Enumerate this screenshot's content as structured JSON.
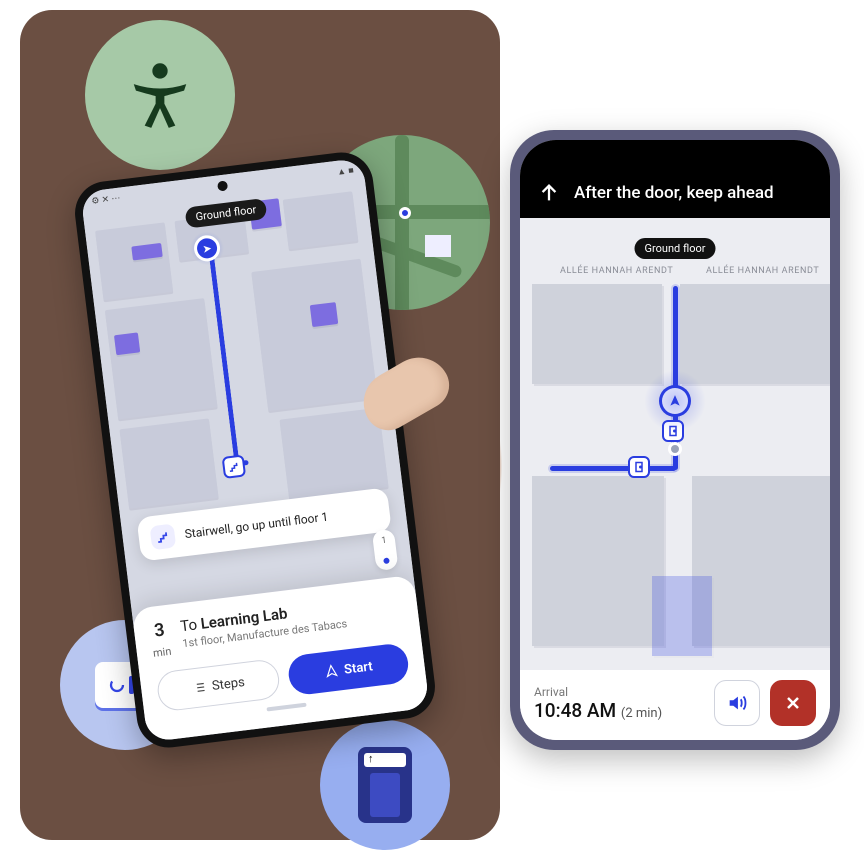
{
  "phone1": {
    "floor_label": "Ground floor",
    "toast": {
      "text": "Stairwell, go up until floor 1"
    },
    "sheet": {
      "duration_num": "3",
      "duration_unit": "min",
      "dest_prefix": "To ",
      "dest_name": "Learning Lab",
      "dest_sub": "1st floor, Manufacture des Tabacs",
      "steps_label": "Steps",
      "start_label": "Start"
    }
  },
  "phone2": {
    "banner": "After the door, keep ahead",
    "floor_label": "Ground floor",
    "street_left": "ALLÉE HANNAH ARENDT",
    "street_right": "ALLÉE HANNAH ARENDT",
    "bottom": {
      "arrival_label": "Arrival",
      "arrival_time": "10:48 AM",
      "arrival_paren": "(2 min)"
    }
  }
}
